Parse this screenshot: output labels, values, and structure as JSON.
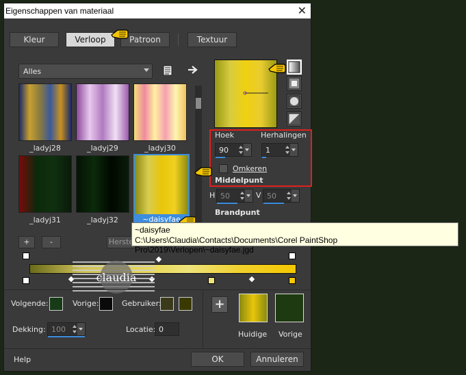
{
  "window": {
    "title": "Eigenschappen van materiaal",
    "close_glyph": "✕"
  },
  "tabs": [
    {
      "label": "Kleur"
    },
    {
      "label": "Verloop"
    },
    {
      "label": "Patroon"
    },
    {
      "label": "Textuur"
    }
  ],
  "gradient_list": {
    "category": "Alles",
    "items": [
      {
        "label": "_ladyj28"
      },
      {
        "label": "_ladyj29"
      },
      {
        "label": "_ladyj30"
      },
      {
        "label": "_ladyj31"
      },
      {
        "label": "_ladyj32"
      },
      {
        "label": "~daisyfae"
      }
    ]
  },
  "properties": {
    "angle_label": "Hoek",
    "angle_value": "90",
    "repeats_label": "Herhalingen",
    "repeats_value": "1",
    "invert_label": "Omkeren",
    "center_label": "Middelpunt",
    "h_label": "H",
    "h_value": "50",
    "v_label": "V",
    "v_value": "50",
    "focal_label": "Brandpunt"
  },
  "tooltip": {
    "name": "~daisyfae",
    "path": "C:\\Users\\Claudia\\Contacts\\Documents\\Corel PaintShop Pro\\2019\\Verlopen\\~daisyfae.jgd"
  },
  "editor": {
    "add_label": "+",
    "remove_label": "-",
    "reset_label": "Herste"
  },
  "bottom": {
    "next_label": "Volgende:",
    "prev_label": "Vorige:",
    "user_label": "Gebruiker:",
    "opacity_label": "Dekking:",
    "opacity_value": "100",
    "location_label": "Locatie:",
    "location_value": "0",
    "add_swatch_label": "+",
    "current_label": "Huidige",
    "previous_label": "Vorige",
    "help_label": "Help",
    "ok_label": "OK",
    "cancel_label": "Annuleren"
  },
  "colors": {
    "accent": "#3c8dde",
    "highlight_border": "#e0201c",
    "current_color": "#e8c60a",
    "previous_color": "#1e3a10"
  }
}
